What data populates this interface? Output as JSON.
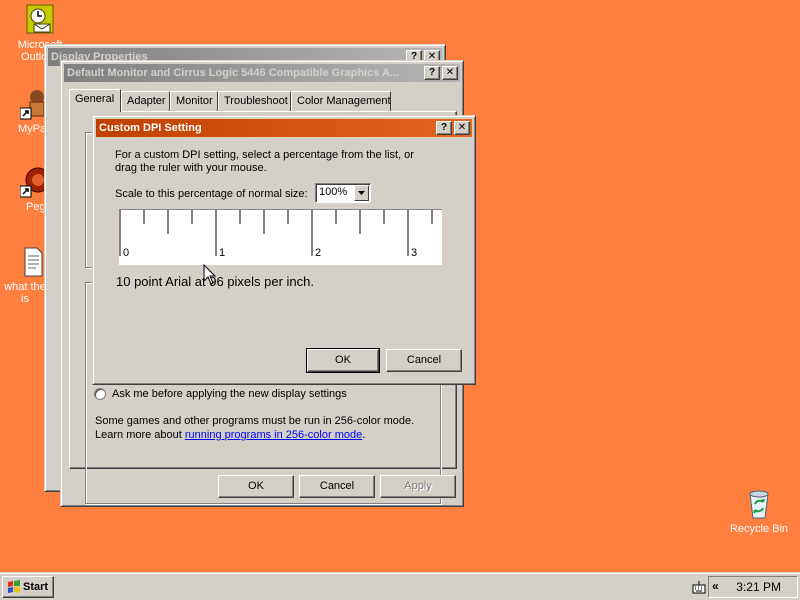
{
  "desktop": {
    "icons": [
      {
        "label": "Microsoft Outlook",
        "icon": "outlook-icon"
      },
      {
        "label": "MyPa",
        "icon": "my-documents-shortcut-icon"
      },
      {
        "label": "Peg",
        "icon": "shortcut-app-icon"
      },
      {
        "label": "what the is",
        "icon": "text-document-icon"
      },
      {
        "label": "Recycle Bin",
        "icon": "recycle-bin-icon"
      }
    ]
  },
  "display_properties": {
    "title": "Display Properties",
    "help_glyph": "?",
    "close_glyph": "✕"
  },
  "monitor_dialog": {
    "title": "Default Monitor and Cirrus Logic 5446 Compatible Graphics A...",
    "help_glyph": "?",
    "close_glyph": "✕",
    "tabs": [
      "General",
      "Adapter",
      "Monitor",
      "Troubleshoot",
      "Color Management"
    ],
    "radio_label": "Ask me before applying the new display settings",
    "note_line1": "Some games and other programs must be run in 256-color mode.",
    "note_prefix": "Learn more about ",
    "note_link": "running programs in 256-color mode",
    "note_suffix": ".",
    "ok_label": "OK",
    "cancel_label": "Cancel",
    "apply_label": "Apply"
  },
  "dpi_dialog": {
    "title": "Custom DPI Setting",
    "help_glyph": "?",
    "close_glyph": "✕",
    "instructions": "For a custom DPI setting, select a percentage from the list, or drag the ruler with your mouse.",
    "scale_label": "Scale to this percentage of normal size:",
    "scale_value": "100%",
    "ruler_numbers": [
      "0",
      "1",
      "2",
      "3"
    ],
    "sample_text": "10 point Arial at 96 pixels per inch.",
    "ok_label": "OK",
    "cancel_label": "Cancel"
  },
  "taskbar": {
    "start_label": "Start",
    "tray_arrow": "«",
    "clock": "3:21 PM"
  }
}
